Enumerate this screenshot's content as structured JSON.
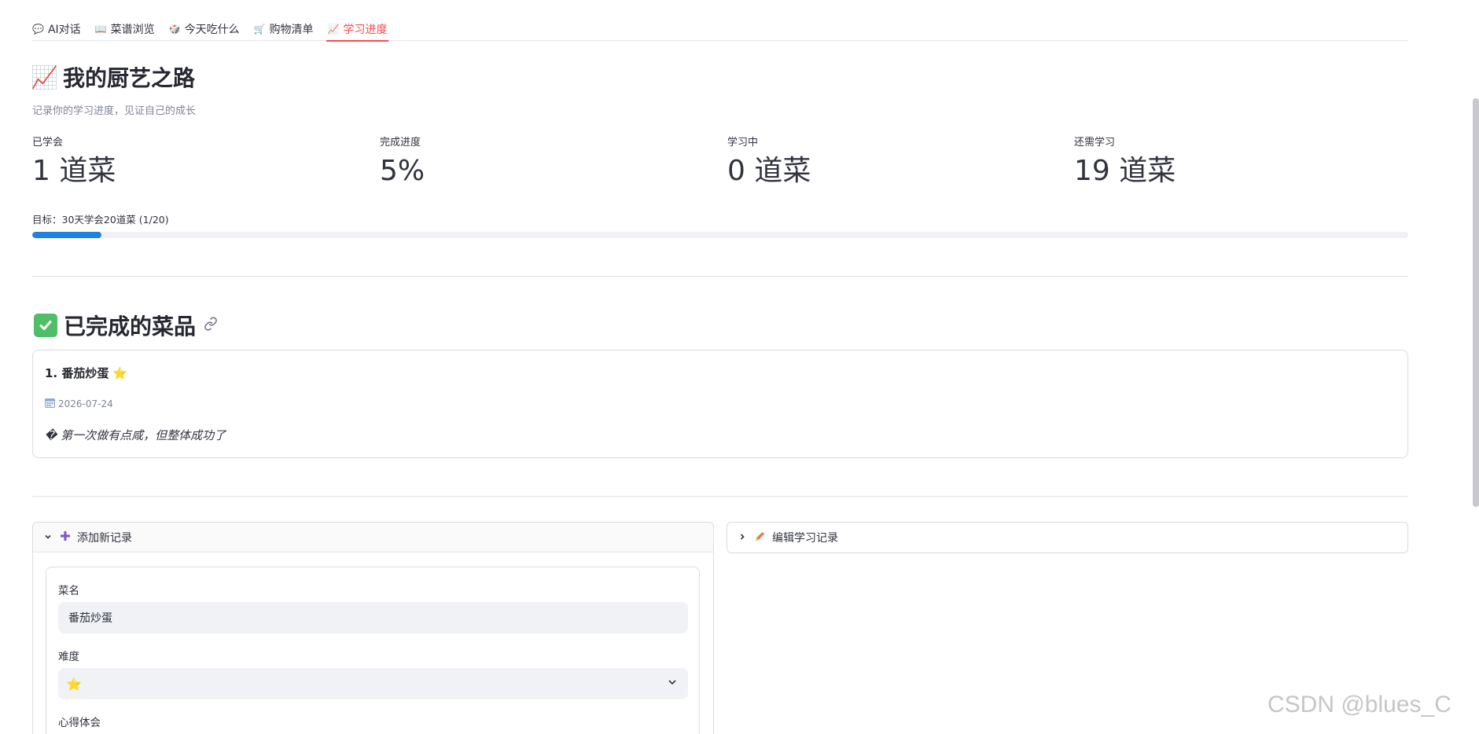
{
  "tabs": [
    {
      "icon": "💬",
      "label": "AI对话",
      "active": false
    },
    {
      "icon": "📖",
      "label": "菜谱浏览",
      "active": false
    },
    {
      "icon": "🎲",
      "label": "今天吃什么",
      "active": false
    },
    {
      "icon": "🛒",
      "label": "购物清单",
      "active": false
    },
    {
      "icon": "📈",
      "label": "学习进度",
      "active": true
    }
  ],
  "header": {
    "icon": "📈",
    "title": "我的厨艺之路",
    "subtitle": "记录你的学习进度，见证自己的成长"
  },
  "metrics": [
    {
      "label": "已学会",
      "value": "1 道菜"
    },
    {
      "label": "完成进度",
      "value": "5%"
    },
    {
      "label": "学习中",
      "value": "0 道菜"
    },
    {
      "label": "还需学习",
      "value": "19 道菜"
    }
  ],
  "goal": {
    "label": "目标：30天学会20道菜 (1/20)",
    "progress": 0.05,
    "color": "#1c83e1"
  },
  "completed": {
    "title": "已完成的菜品",
    "items": [
      {
        "name": "1. 番茄炒蛋",
        "stars": "⭐",
        "date": "2026-07-24",
        "note": "� 第一次做有点咸，但整体成功了"
      }
    ]
  },
  "add_record": {
    "label": "添加新记录",
    "expanded": true,
    "fields": {
      "dish_label": "菜名",
      "dish_value": "番茄炒蛋",
      "difficulty_label": "难度",
      "difficulty_value": "⭐",
      "notes_label": "心得体会"
    }
  },
  "edit_record": {
    "label": "编辑学习记录",
    "expanded": false
  },
  "watermark": "CSDN @blues_C",
  "colors": {
    "accent": "#ff4b4b",
    "progress": "#1c83e1",
    "check_green": "#4fbf67"
  }
}
